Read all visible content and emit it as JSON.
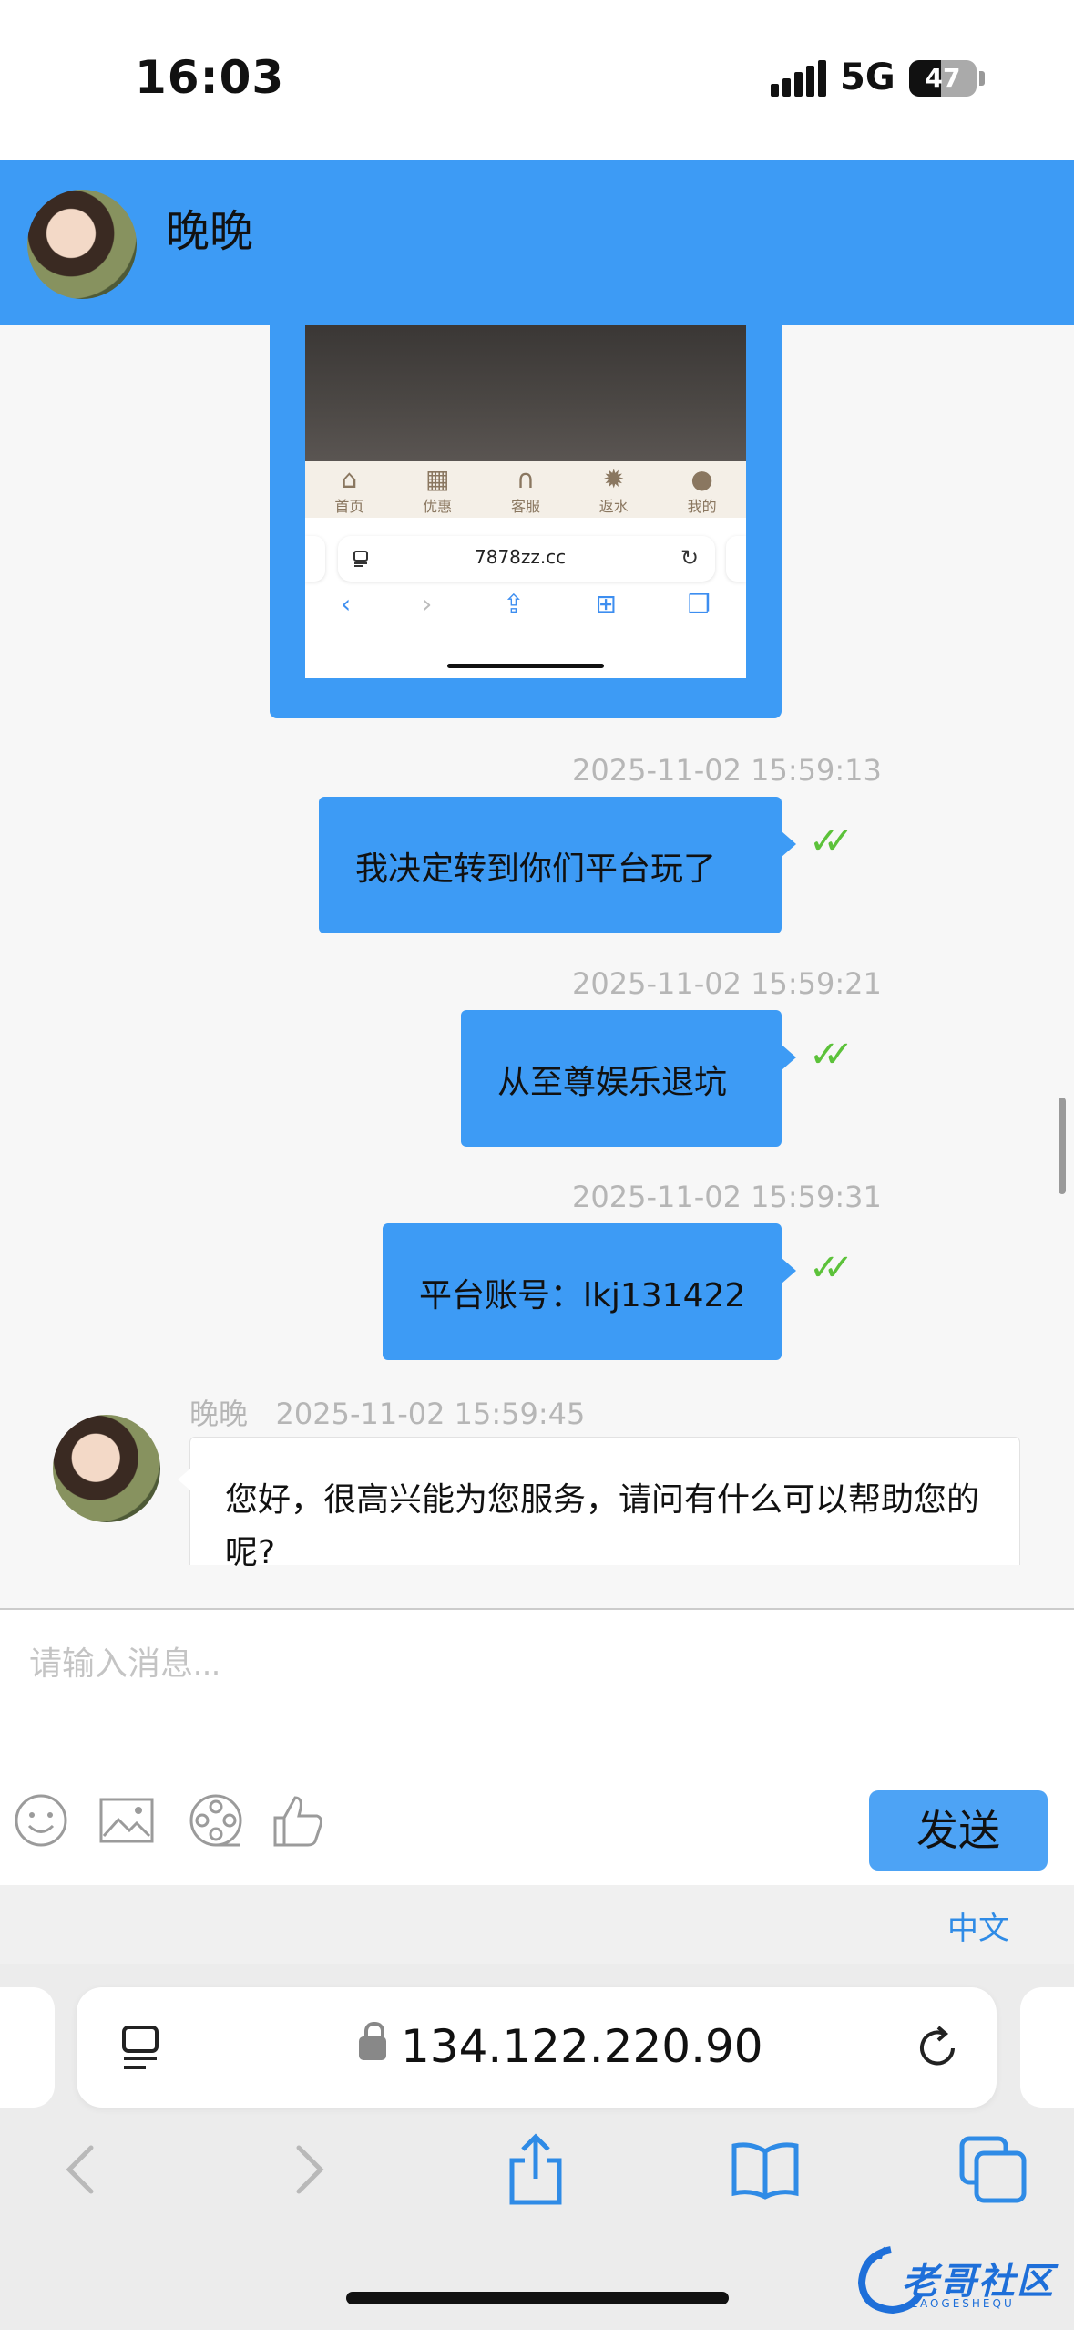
{
  "status_bar": {
    "time": "16:03",
    "network": "5G",
    "battery": "47",
    "battery_level_percent": 47
  },
  "chat_header": {
    "name": "晚晚"
  },
  "embedded_screenshot": {
    "tabs": [
      {
        "label": "首页",
        "icon": "home-icon"
      },
      {
        "label": "优惠",
        "icon": "gift-icon"
      },
      {
        "label": "客服",
        "icon": "headset-icon"
      },
      {
        "label": "返水",
        "icon": "coin-icon"
      },
      {
        "label": "我的",
        "icon": "user-icon"
      }
    ],
    "url": "7878zz.cc"
  },
  "messages": [
    {
      "timestamp": "2025-11-02 15:59:13",
      "text": "我决定转到你们平台玩了"
    },
    {
      "timestamp": "2025-11-02 15:59:21",
      "text": "从至尊娱乐退坑"
    },
    {
      "timestamp": "2025-11-02 15:59:31",
      "text": "平台账号：lkj131422"
    }
  ],
  "incoming": {
    "name": "晚晚",
    "timestamp": "2025-11-02 15:59:45",
    "text": "您好，很高兴能为您服务，请问有什么可以帮助您的呢?"
  },
  "composer": {
    "placeholder": "请输入消息...",
    "send_label": "发送"
  },
  "keyboard": {
    "language": "中文"
  },
  "browser": {
    "url": "134.122.220.90"
  },
  "watermark": {
    "text": "老哥社区",
    "sub": "LAOGESHEQU"
  },
  "colors": {
    "accent": "#3d9bf5",
    "check": "#5cc23a",
    "link": "#2f8be6"
  }
}
